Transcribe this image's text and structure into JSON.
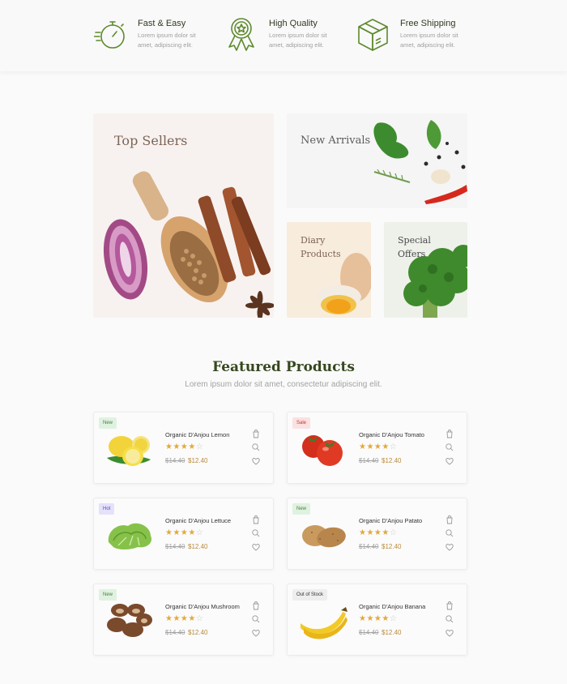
{
  "features": [
    {
      "title": "Fast & Easy",
      "desc": "Lorem ipsum dolor sit amet, adipiscing elit.",
      "icon": "stopwatch-icon"
    },
    {
      "title": "High Quality",
      "desc": "Lorem ipsum dolor sit amet, adipiscing elit.",
      "icon": "award-ribbon-icon"
    },
    {
      "title": "Free Shipping",
      "desc": "Lorem ipsum dolor sit amet, adipiscing elit.",
      "icon": "package-box-icon"
    }
  ],
  "banners": {
    "top_sellers": "Top Sellers",
    "new_arrivals": "New Arrivals",
    "dairy": "Diary Products",
    "special": "Special Offers"
  },
  "featured": {
    "title": "Featured Products",
    "subtitle": "Lorem ipsum dolor sit amet, consectetur adipiscing elit."
  },
  "products": [
    {
      "name": "Organic D'Anjou Lemon",
      "badge": "New",
      "old_price": "$14.40",
      "price": "$12.40",
      "rating": 4
    },
    {
      "name": "Organic D'Anjou Tomato",
      "badge": "Sale",
      "old_price": "$14.40",
      "price": "$12.40",
      "rating": 4
    },
    {
      "name": "Organic D'Anjou Lettuce",
      "badge": "Hot",
      "old_price": "$14.40",
      "price": "$12.40",
      "rating": 4
    },
    {
      "name": "Organic D'Anjou Patato",
      "badge": "New",
      "old_price": "$14.40",
      "price": "$12.40",
      "rating": 4
    },
    {
      "name": "Organic D'Anjou Mushroom",
      "badge": "New",
      "old_price": "$14.40",
      "price": "$12.40",
      "rating": 4
    },
    {
      "name": "Organic D'Anjou Banana",
      "badge": "Out of Stock",
      "old_price": "$14.40",
      "price": "$12.40",
      "rating": 4
    }
  ],
  "colors": {
    "accent": "#5e8a2e",
    "star": "#e2a93b",
    "price": "#b98a3a",
    "heading": "#36481f"
  }
}
